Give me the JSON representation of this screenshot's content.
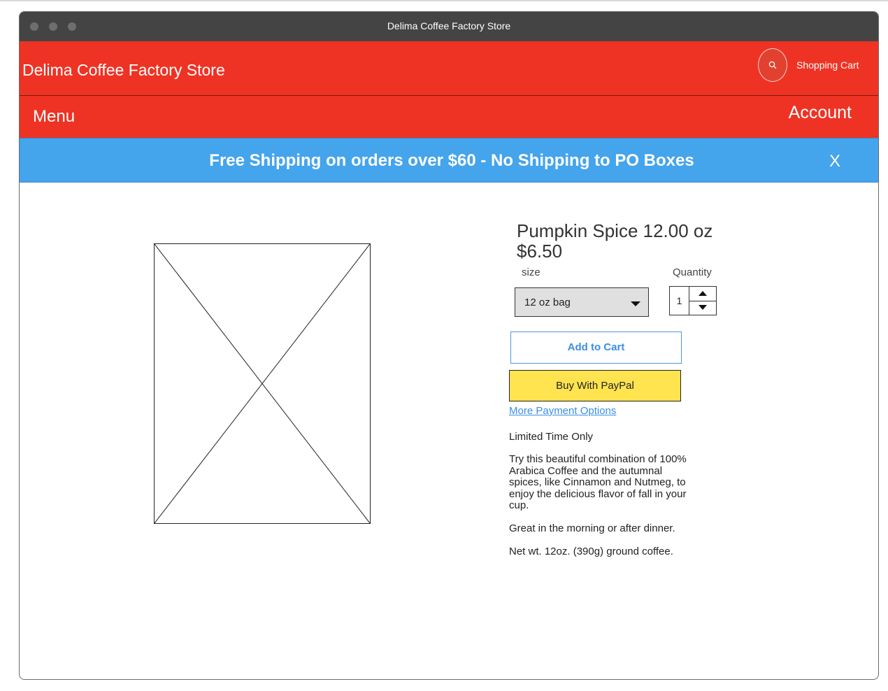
{
  "window": {
    "title": "Delima Coffee Factory Store"
  },
  "header": {
    "store_name": "Delima Coffee Factory Store",
    "search_icon": "search-icon",
    "cart_label": "Shopping Cart",
    "brand_color": "#ee3324"
  },
  "nav": {
    "menu_label": "Menu",
    "account_label": "Account"
  },
  "banner": {
    "text": "Free Shipping on orders over $60 - No Shipping to PO Boxes",
    "close_label": "X",
    "color": "#44a4ec"
  },
  "product": {
    "title": "Pumpkin Spice 12.00 oz",
    "price": "$6.50",
    "size_label": "size",
    "size_value": "12 oz bag",
    "quantity_label": "Quantity",
    "quantity_value": "1",
    "add_to_cart": "Add to Cart",
    "paypal": "Buy With PayPal",
    "paypal_color": "#ffe34f",
    "more_payment": "More Payment Options",
    "limited": "Limited Time Only",
    "description": "Try this beautiful combination of 100% Arabica Coffee and the autumnal spices, like Cinnamon and Nutmeg, to enjoy the delicious flavor of fall in your cup.",
    "serving_note": "Great in the morning or after dinner.",
    "net_weight": "Net wt. 12oz. (390g) ground coffee."
  }
}
